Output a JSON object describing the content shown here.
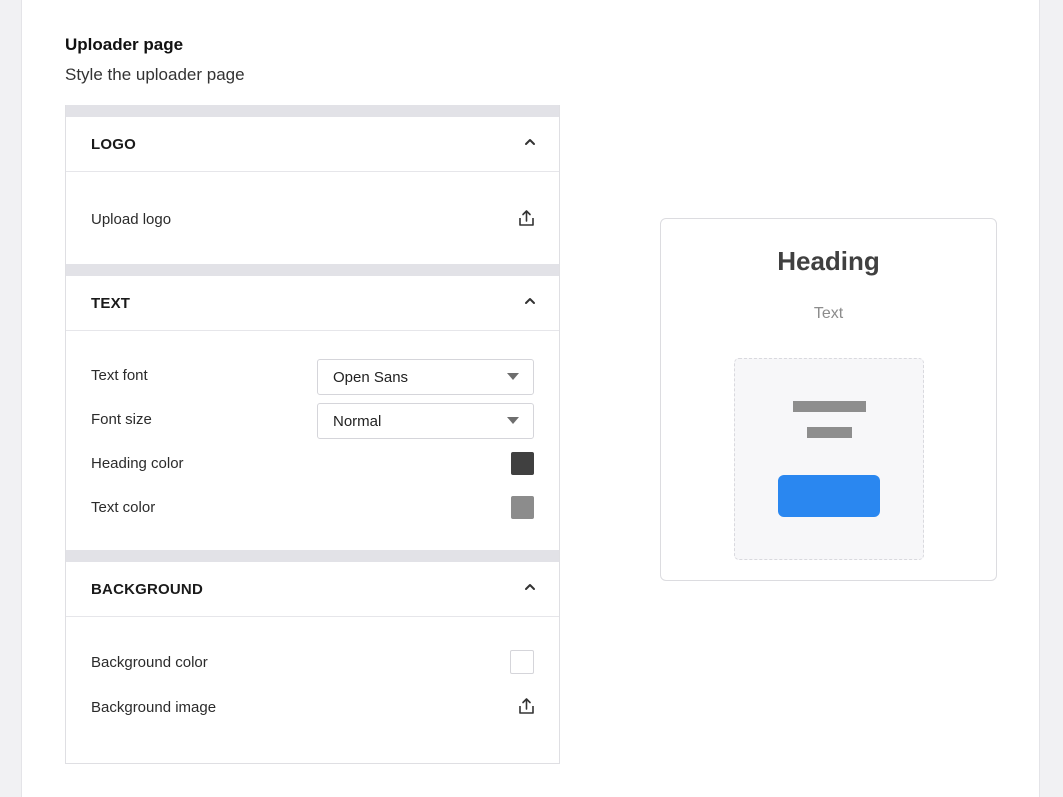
{
  "header": {
    "title": "Uploader page",
    "subtitle": "Style the uploader page"
  },
  "sections": {
    "logo": {
      "title": "LOGO",
      "upload_label": "Upload logo"
    },
    "text": {
      "title": "TEXT",
      "font_label": "Text font",
      "font_value": "Open Sans",
      "size_label": "Font size",
      "size_value": "Normal",
      "heading_color_label": "Heading color",
      "heading_color": "#404040",
      "text_color_label": "Text color",
      "text_color": "#8c8c8c"
    },
    "background": {
      "title": "BACKGROUND",
      "color_label": "Background color",
      "color": "#ffffff",
      "image_label": "Background image"
    }
  },
  "preview": {
    "heading": "Heading",
    "text": "Text",
    "button_color": "#2a87f0"
  },
  "icons": {
    "collapse": "chevron-up-icon",
    "upload": "upload-icon"
  }
}
